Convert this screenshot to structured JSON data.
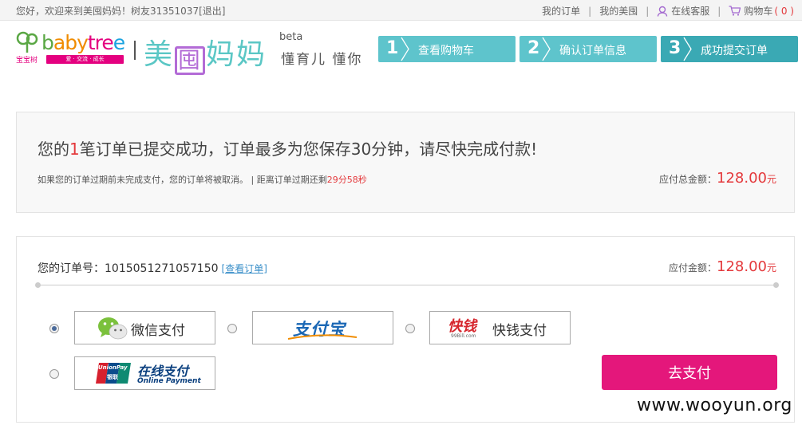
{
  "topbar": {
    "greeting": "您好，欢迎来到美囤妈妈！树友31351037[退出]",
    "my_orders": "我的订单",
    "sep": "|",
    "my_meitun": "我的美囤",
    "service": "在线客服",
    "cart": "购物车",
    "cart_count": "( 0 )"
  },
  "header": {
    "brand_word_parts": [
      "b",
      "aby",
      "tre",
      "e"
    ],
    "brand_cn": "宝宝树",
    "brand_strip": "爱 · 交流 · 成长",
    "site_name_a": "美",
    "site_name_box": "囤",
    "site_name_b": "妈妈",
    "beta": "beta",
    "slogan": "懂育儿 懂你",
    "steps": [
      {
        "num": "1",
        "label": "查看购物车"
      },
      {
        "num": "2",
        "label": "确认订单信息"
      },
      {
        "num": "3",
        "label": "成功提交订单"
      }
    ]
  },
  "notice": {
    "headline_pre": "您的",
    "headline_count": "1",
    "headline_post": "笔订单已提交成功，订单最多为您保存30分钟，请尽快完成付款!",
    "tip": "如果您的订单过期前未完成支付，您的订单将被取消。 | 距离订单过期还剩",
    "countdown": "29分58秒",
    "total_label": "应付总金额：",
    "total_amount": "128.00",
    "unit": "元"
  },
  "payment": {
    "order_label": "您的订单号：1015051271057150",
    "view_order": "[查看订单]",
    "due_label": "应付金额：",
    "due_amount": "128.00",
    "unit": "元",
    "methods": [
      {
        "name": "wechat",
        "label": "微信支付",
        "checked": true
      },
      {
        "name": "alipay",
        "label": "支付宝",
        "checked": false
      },
      {
        "name": "kuaiqian",
        "logo": "快钱",
        "logo_sub": "99Bill.com",
        "label": "快钱支付",
        "checked": false
      },
      {
        "name": "unionpay",
        "logo": "UnionPay",
        "logo_sub": "银联",
        "label": "在线支付",
        "sub": "Online Payment",
        "checked": false
      }
    ],
    "pay_button": "去支付"
  },
  "watermark": "www.wooyun.org",
  "colors": {
    "accent_pink": "#e4177b",
    "step_teal": "#5ec4cc",
    "price_red": "#e4393c",
    "link_blue": "#3a8fc9"
  }
}
